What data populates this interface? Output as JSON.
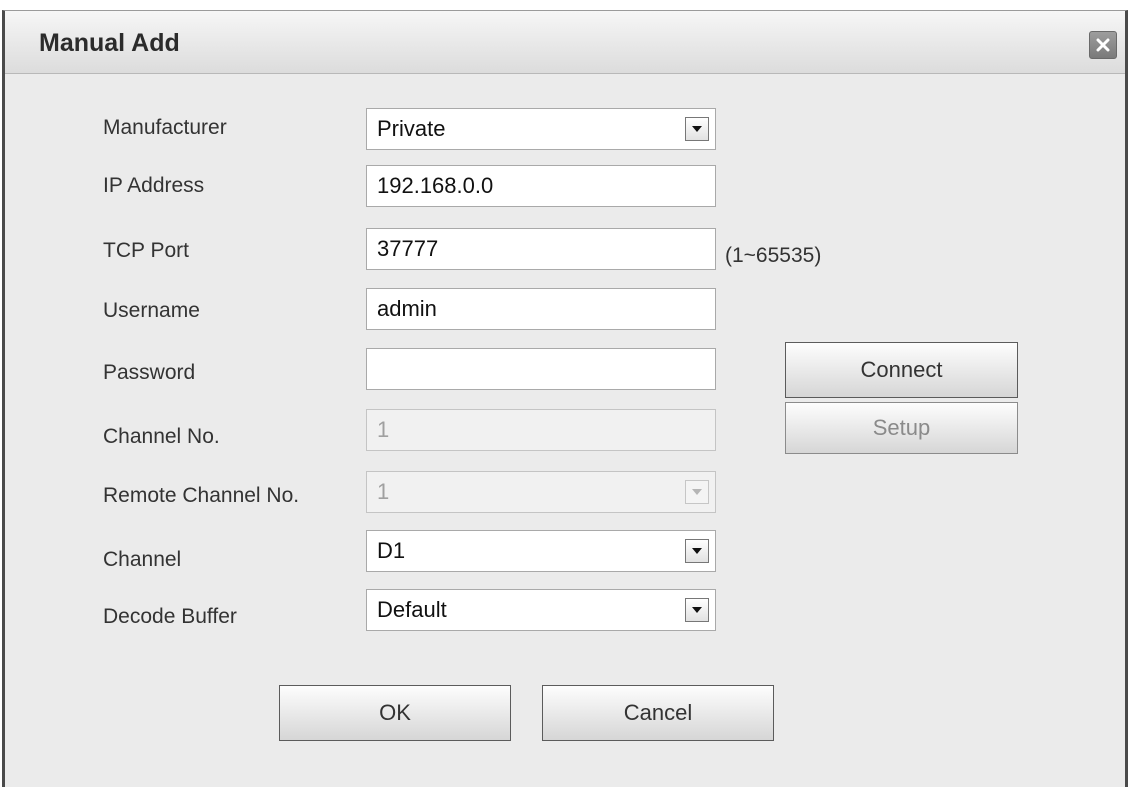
{
  "dialog": {
    "title": "Manual Add"
  },
  "icons": {
    "close": "close-icon",
    "dropdown": "chevron-down-icon"
  },
  "form": {
    "manufacturer": {
      "label": "Manufacturer",
      "value": "Private"
    },
    "ip_address": {
      "label": "IP Address",
      "value": "192.168.0.0"
    },
    "tcp_port": {
      "label": "TCP Port",
      "value": "37777",
      "hint": "(1~65535)"
    },
    "username": {
      "label": "Username",
      "value": "admin"
    },
    "password": {
      "label": "Password",
      "value": ""
    },
    "channel_no": {
      "label": "Channel No.",
      "value": "1"
    },
    "remote_channel_no": {
      "label": "Remote Channel No.",
      "value": "1"
    },
    "channel": {
      "label": "Channel",
      "value": "D1"
    },
    "decode_buffer": {
      "label": "Decode Buffer",
      "value": "Default"
    }
  },
  "buttons": {
    "connect": "Connect",
    "setup": "Setup",
    "ok": "OK",
    "cancel": "Cancel"
  },
  "colors": {
    "dialog_bg": "#ebebeb",
    "frame": "#4a4a4a"
  }
}
